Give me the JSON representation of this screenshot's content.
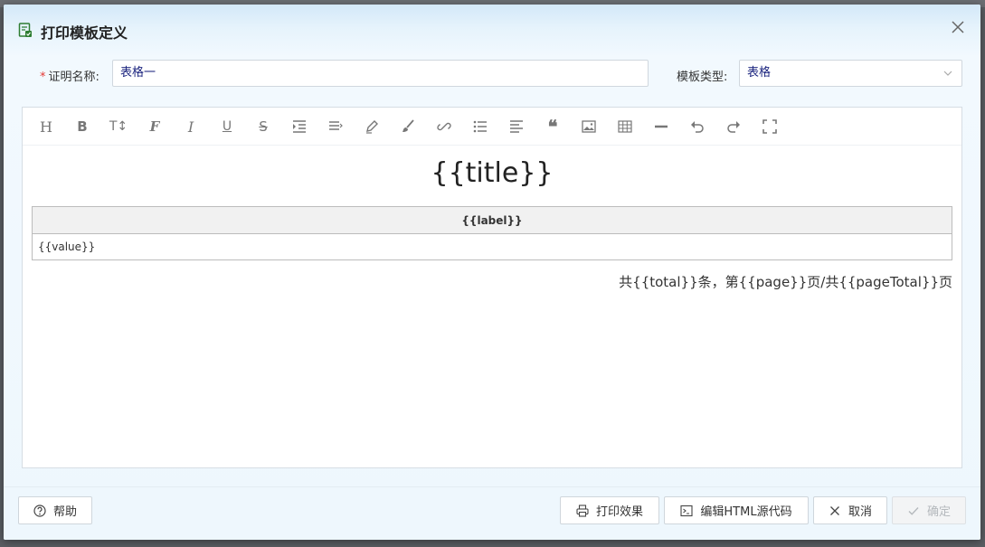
{
  "dialog": {
    "title": "打印模板定义",
    "close_icon": "close-icon",
    "title_icon": "document-icon"
  },
  "form": {
    "name_label": "证明名称:",
    "name_required_mark": "*",
    "name_value": "表格一",
    "type_label": "模板类型:",
    "type_value": "表格"
  },
  "toolbar": {
    "items": [
      "heading-icon",
      "bold-icon",
      "text-size-icon",
      "font-icon",
      "italic-icon",
      "underline-icon",
      "strikethrough-icon",
      "indent-icon",
      "line-height-icon",
      "highlight-icon",
      "format-brush-icon",
      "link-icon",
      "list-icon",
      "align-icon",
      "quote-icon",
      "image-icon",
      "table-icon",
      "divider-icon",
      "undo-icon",
      "redo-icon",
      "fullscreen-icon"
    ]
  },
  "document": {
    "title": "{{title}}",
    "table_header": "{{label}}",
    "table_cell": "{{value}}",
    "pagination": "共{{total}}条，第{{page}}页/共{{pageTotal}}页"
  },
  "buttons": {
    "help": "帮助",
    "print_preview": "打印效果",
    "edit_html": "编辑HTML源代码",
    "cancel": "取消",
    "confirm": "确定"
  },
  "colors": {
    "input_text": "#1a237e",
    "required": "#e53935",
    "title_icon": "#2e7d32"
  }
}
